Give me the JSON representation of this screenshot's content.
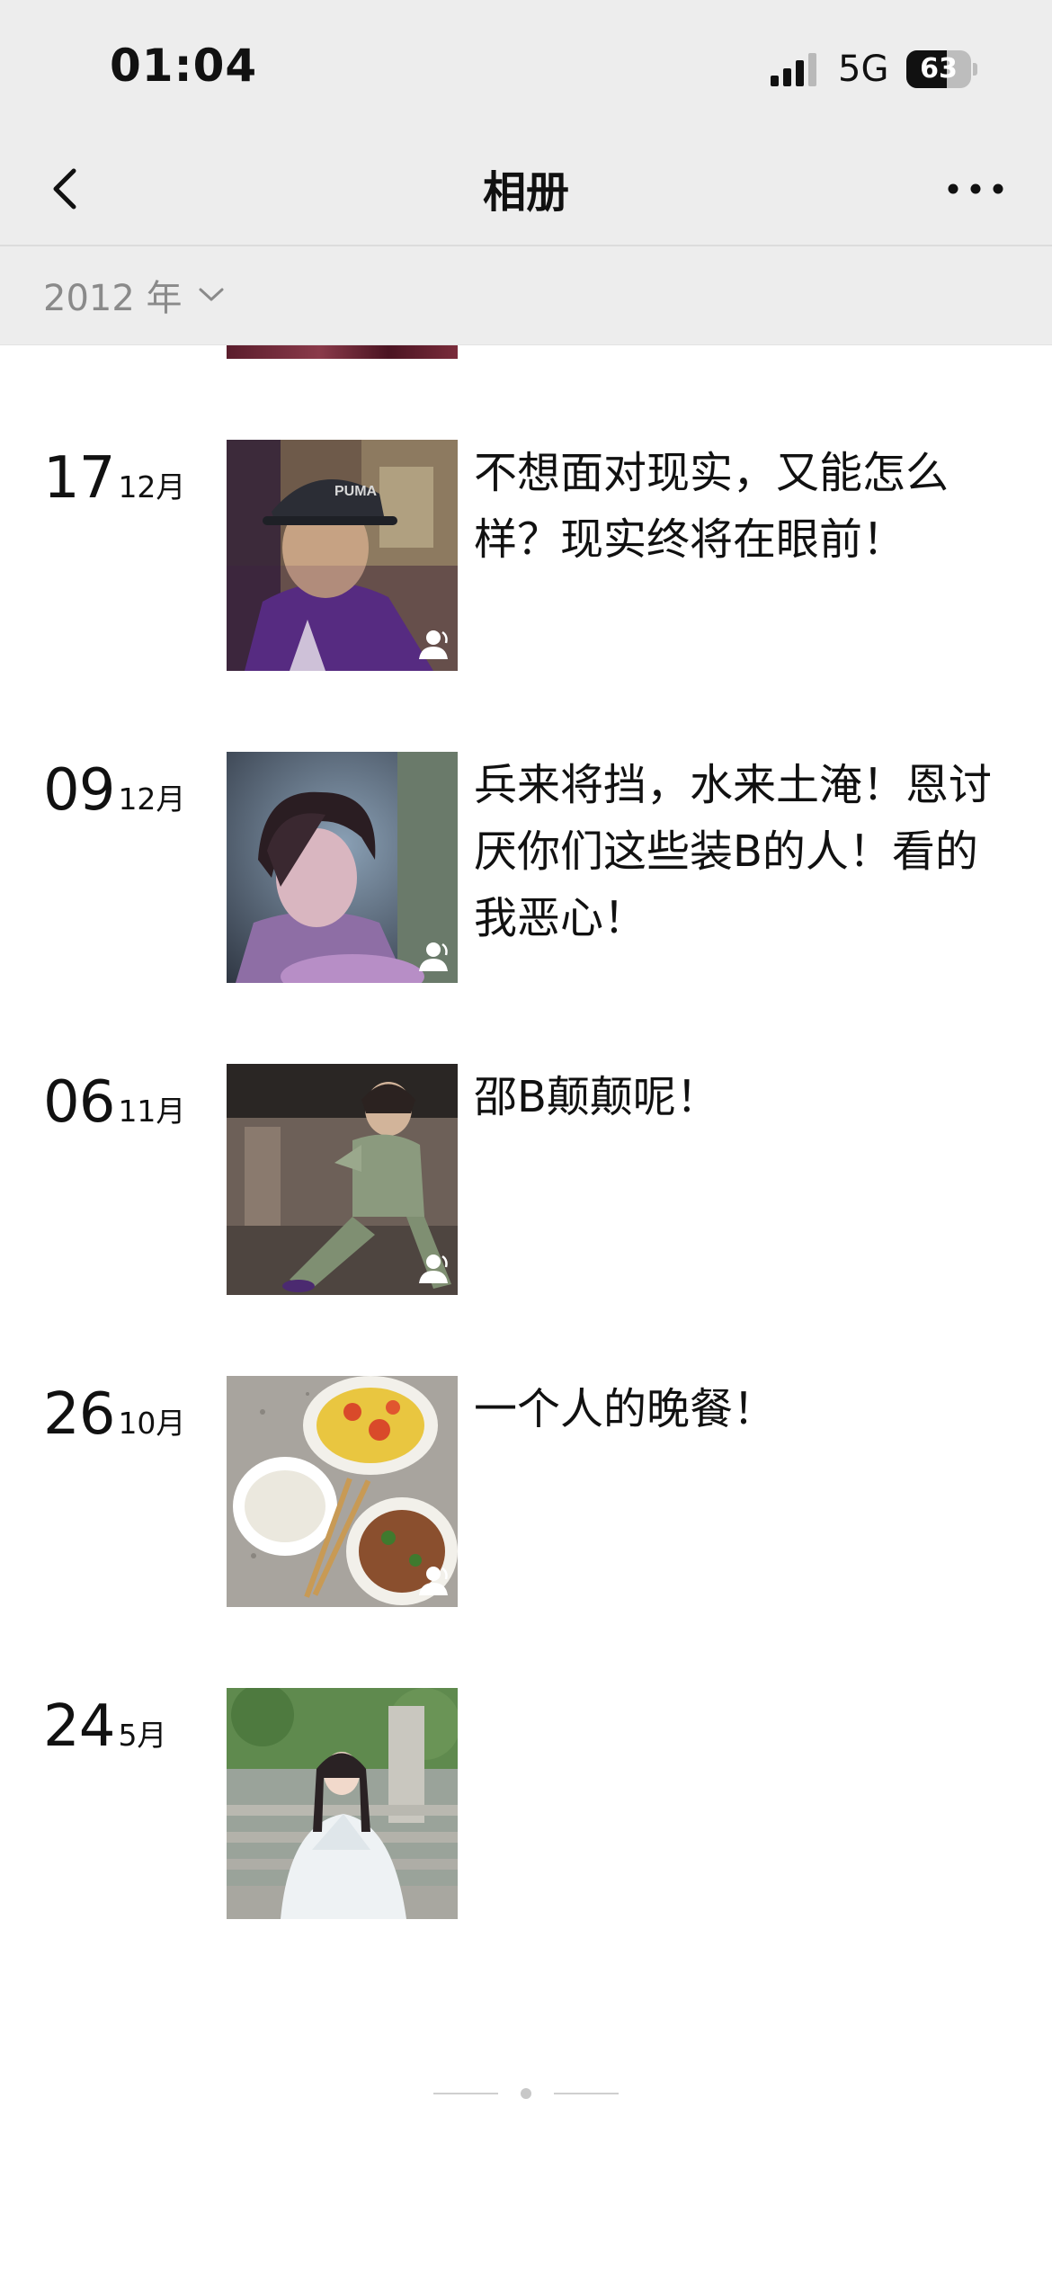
{
  "status_bar": {
    "time": "01:04",
    "network": "5G",
    "battery": "63",
    "battery_level": 0.63,
    "signal_icon": "cellular-signal-icon",
    "battery_icon": "battery-icon"
  },
  "nav": {
    "title": "相册",
    "back_icon": "chevron-left-icon",
    "more_icon": "ellipsis-icon"
  },
  "year_filter": {
    "label": "2012 年",
    "icon": "chevron-down-icon"
  },
  "entries": [
    {
      "day": "17",
      "month": "12月",
      "caption": "不想面对现实，又能怎么样？现实终将在眼前！",
      "visibility_icon": "friend-icon"
    },
    {
      "day": "09",
      "month": "12月",
      "caption": "兵来将挡，水来土淹！恩讨厌你们这些装B的人！看的我恶心！",
      "visibility_icon": "friend-icon"
    },
    {
      "day": "06",
      "month": "11月",
      "caption": "邵B颠颠呢！",
      "visibility_icon": "friend-icon"
    },
    {
      "day": "26",
      "month": "10月",
      "caption": "一个人的晚餐！",
      "visibility_icon": "friend-icon"
    },
    {
      "day": "24",
      "month": "5月",
      "caption": "",
      "visibility_icon": ""
    }
  ],
  "colors": {
    "header_background": "#ededed",
    "page_background": "#ffffff",
    "muted_text": "#8a8a8a",
    "primary_text": "#111111"
  }
}
